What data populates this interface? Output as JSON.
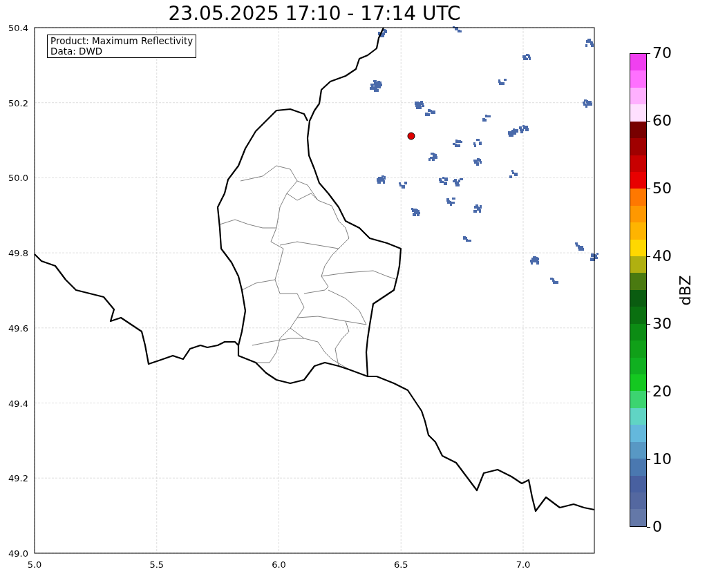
{
  "title": "23.05.2025 17:10 - 17:14 UTC",
  "info_box": [
    "Product: Maximum Reflectivity",
    "Data: DWD"
  ],
  "map": {
    "xticks": [
      "5.0",
      "5.5",
      "6.0",
      "6.5",
      "7.0"
    ],
    "yticks": [
      "50.4",
      "50.2",
      "50.0",
      "49.8",
      "49.6",
      "49.4",
      "49.2",
      "49.0"
    ]
  },
  "colorbar": {
    "label": "dBZ",
    "ticks": [
      "70",
      "60",
      "50",
      "40",
      "30",
      "20",
      "10",
      "0"
    ],
    "bands": [
      {
        "color": "#f040f0"
      },
      {
        "color": "#ff70ff"
      },
      {
        "color": "#ffb0ff"
      },
      {
        "color": "#ffe0ff"
      },
      {
        "color": "#780000"
      },
      {
        "color": "#a00000"
      },
      {
        "color": "#c80000"
      },
      {
        "color": "#e80000"
      },
      {
        "color": "#ff7800"
      },
      {
        "color": "#ff9800"
      },
      {
        "color": "#ffb400"
      },
      {
        "color": "#ffd800"
      },
      {
        "color": "#b0b010"
      },
      {
        "color": "#4a7a10"
      },
      {
        "color": "#0a5c10"
      },
      {
        "color": "#0a7010"
      },
      {
        "color": "#0c8c14"
      },
      {
        "color": "#10a018"
      },
      {
        "color": "#10b020"
      },
      {
        "color": "#14c820"
      },
      {
        "color": "#3cd470"
      },
      {
        "color": "#60d4c4"
      },
      {
        "color": "#64b8dc"
      },
      {
        "color": "#5898c4"
      },
      {
        "color": "#4a78b0"
      },
      {
        "color": "#4860a0"
      },
      {
        "color": "#5468a0"
      },
      {
        "color": "#6478a8"
      }
    ]
  }
}
